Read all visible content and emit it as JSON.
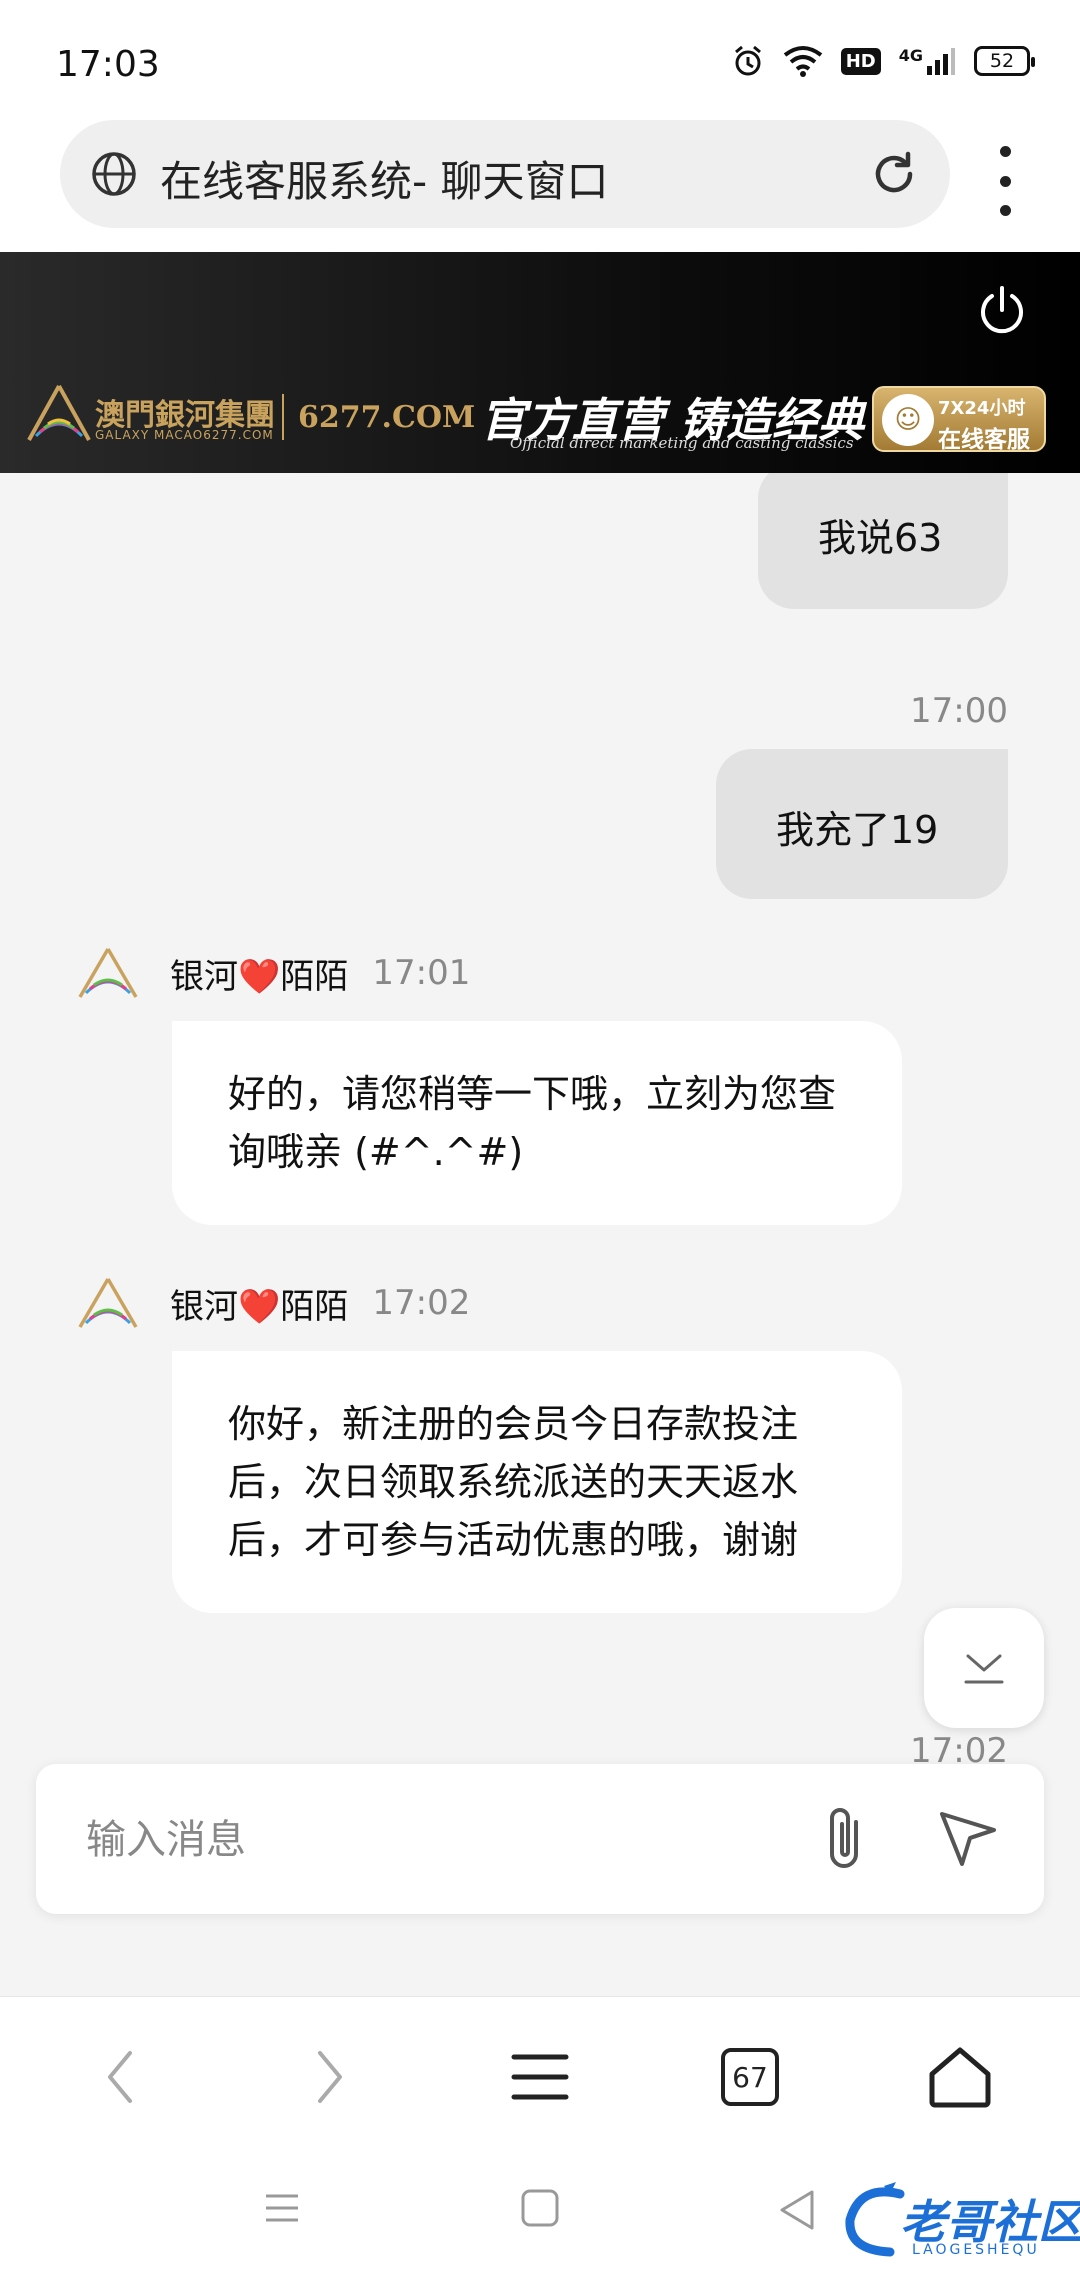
{
  "status_bar": {
    "time": "17:03",
    "network": "4G",
    "hd": "HD",
    "battery": "52"
  },
  "address_bar": {
    "title": "在线客服系统- 聊天窗口"
  },
  "banner": {
    "brand_name": "澳門銀河集團",
    "brand_sub": "GALAXY MACAO6277.COM",
    "domain": "6277.COM",
    "slogan": "官方直营 铸造经典",
    "slogan_en": "Official direct marketing and casting classics",
    "service_line1": "7X24小时",
    "service_line2": "在线客服"
  },
  "messages": [
    {
      "dir": "out",
      "text": "我说63"
    },
    {
      "dir": "out",
      "time": "17:00",
      "text": "我充了19"
    },
    {
      "dir": "in",
      "sender": "银河❤️陌陌",
      "time": "17:01",
      "text": "好的，请您稍等一下哦，立刻为您查询哦亲 (#^.^#)"
    },
    {
      "dir": "in",
      "sender": "银河❤️陌陌",
      "time": "17:02",
      "text": "你好，新注册的会员今日存款投注后，次日领取系统派送的天天返水后，才可参与活动优惠的哦，谢谢"
    },
    {
      "dir": "out",
      "time": "17:02"
    }
  ],
  "input": {
    "placeholder": "输入消息"
  },
  "toolbar": {
    "tab_count": "67"
  },
  "watermark": {
    "text": "老哥社区",
    "sub": "LAOGESHEQU"
  },
  "colors": {
    "banner_gold": "#c9a35e",
    "bubble_out": "#e2e2e2",
    "bubble_in": "#ffffff",
    "watermark_blue": "#1d6fd8"
  }
}
